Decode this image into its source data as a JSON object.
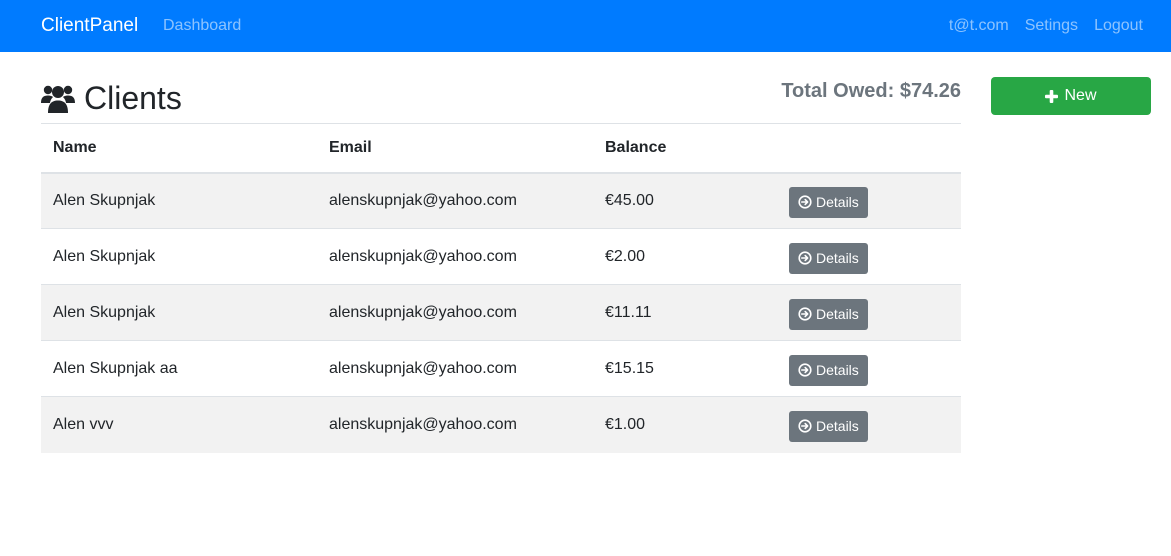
{
  "navbar": {
    "brand": "ClientPanel",
    "dashboard": "Dashboard",
    "email": "t@t.com",
    "settings": "Setings",
    "logout": "Logout",
    "background_color": "#007bff"
  },
  "page": {
    "title": "Clients",
    "title_icon": "users-icon",
    "total_owed": "Total Owed: $74.26"
  },
  "new_button": {
    "label": "New",
    "icon": "plus-icon",
    "color": "#28a745"
  },
  "table": {
    "headers": [
      "Name",
      "Email",
      "Balance",
      ""
    ],
    "rows": [
      {
        "name": "Alen Skupnjak",
        "email": "alenskupnjak@yahoo.com",
        "balance": "€45.00",
        "action": "Details"
      },
      {
        "name": "Alen Skupnjak",
        "email": "alenskupnjak@yahoo.com",
        "balance": "€2.00",
        "action": "Details"
      },
      {
        "name": "Alen Skupnjak",
        "email": "alenskupnjak@yahoo.com",
        "balance": "€11.11",
        "action": "Details"
      },
      {
        "name": "Alen Skupnjak aa",
        "email": "alenskupnjak@yahoo.com",
        "balance": "€15.15",
        "action": "Details"
      },
      {
        "name": "Alen vvv",
        "email": "alenskupnjak@yahoo.com",
        "balance": "€1.00",
        "action": "Details"
      }
    ],
    "details_icon": "arrow-circle-right-icon",
    "details_color": "#6c757d"
  }
}
